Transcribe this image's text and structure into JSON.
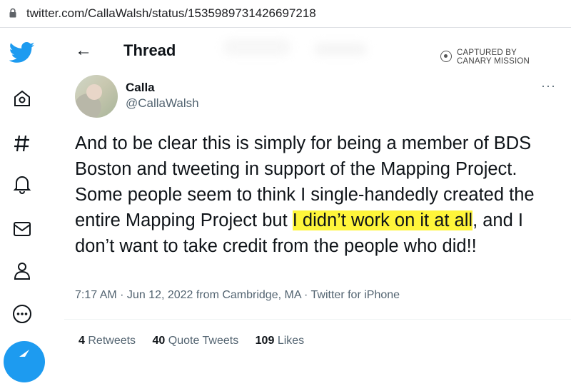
{
  "browser": {
    "url": "twitter.com/CallaWalsh/status/1535989731426697218"
  },
  "nav": {
    "items": [
      "twitter-logo",
      "home-icon",
      "explore-icon",
      "notifications-icon",
      "messages-icon",
      "profile-icon",
      "more-icon",
      "compose-button"
    ]
  },
  "header": {
    "back_label": "←",
    "title": "Thread"
  },
  "watermark": {
    "line1": "CAPTURED BY",
    "line2": "CANARY MISSION"
  },
  "tweet": {
    "author_name": "Calla",
    "author_handle": "@CallaWalsh",
    "more_label": "···",
    "text_before": "And to be clear this is simply for being a member of BDS Boston and tweeting in support of the Mapping Project. Some people seem to think I single-handedly created the entire Mapping Project but ",
    "text_highlight": "I didn’t work on it at all",
    "text_after": ", and I don’t want to take credit from the people who did!!",
    "timestamp": "7:17 AM · Jun 12, 2022 from Cambridge, MA · Twitter for iPhone",
    "stats": {
      "retweets_count": "4",
      "retweets_label": "Retweets",
      "quotes_count": "40",
      "quotes_label": "Quote Tweets",
      "likes_count": "109",
      "likes_label": "Likes"
    }
  },
  "colors": {
    "accent": "#1d9bf0",
    "highlight": "#fff53a",
    "secondary_text": "#536471"
  }
}
